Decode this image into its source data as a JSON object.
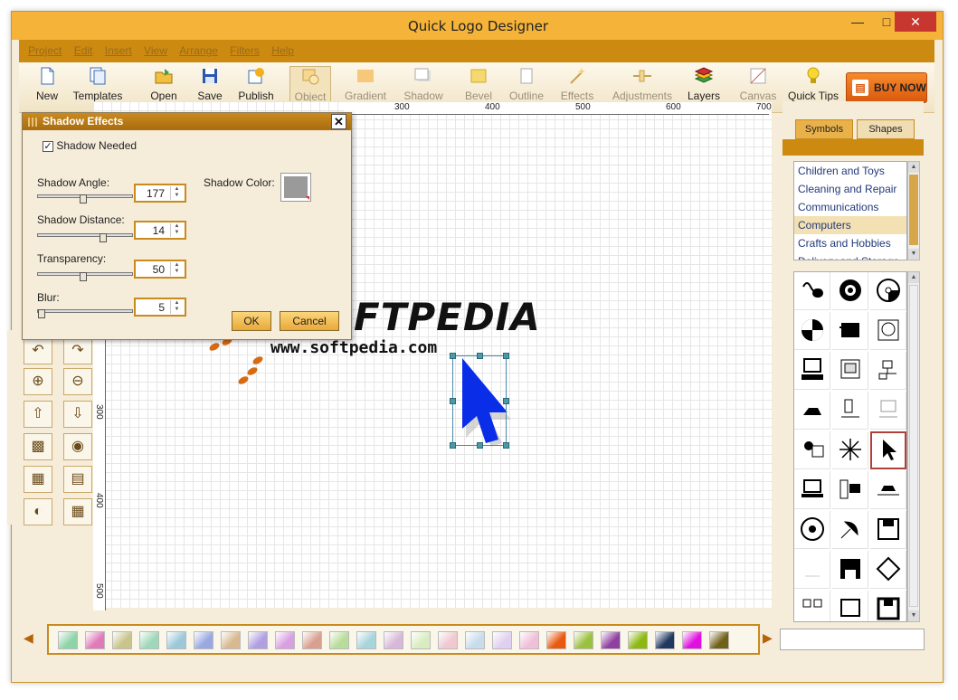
{
  "window": {
    "title": "Quick Logo Designer"
  },
  "menu": [
    "Project",
    "Edit",
    "Insert",
    "View",
    "Arrange",
    "Filters",
    "Help"
  ],
  "toolbar": {
    "new": "New",
    "templates": "Templates",
    "open": "Open",
    "save": "Save",
    "publish": "Publish",
    "object": "Object",
    "gradient": "Gradient",
    "shadow": "Shadow",
    "bevel": "Bevel",
    "outline": "Outline",
    "effects": "Effects",
    "adjustments": "Adjustments",
    "layers": "Layers",
    "canvas": "Canvas",
    "quick_tips": "Quick Tips",
    "buy_now": "BUY NOW"
  },
  "dialog": {
    "title": "Shadow Effects",
    "shadow_needed": "Shadow Needed",
    "shadow_needed_checked": true,
    "angle_label": "Shadow Angle:",
    "angle_value": "177",
    "distance_label": "Shadow Distance:",
    "distance_value": "14",
    "transparency_label": "Transparency:",
    "transparency_value": "50",
    "blur_label": "Blur:",
    "blur_value": "5",
    "color_label": "Shadow Color:",
    "shadow_color": "#9a9a9a",
    "ok": "OK",
    "cancel": "Cancel"
  },
  "ruler": {
    "top": [
      "300",
      "400",
      "500",
      "600",
      "700"
    ],
    "left": [
      "300",
      "400",
      "500"
    ]
  },
  "canvas": {
    "logo_text": "FTPEDIA",
    "url_text": "www.softpedia.com",
    "cursor_color": "#0a2ee8"
  },
  "right_panel": {
    "tab_symbols": "Symbols",
    "tab_shapes": "Shapes",
    "categories": [
      "Children and Toys",
      "Cleaning and Repair",
      "Communications",
      "Computers",
      "Crafts and Hobbies",
      "Delivery and Storage"
    ],
    "selected_category": "Computers"
  },
  "gradients": [
    "#8fd4a8",
    "#e07ab8",
    "#c8c48a",
    "#9ed8b8",
    "#9cc8d8",
    "#9aa8e0",
    "#d8b890",
    "#b0a0e0",
    "#d8a0e0",
    "#d8a090",
    "#b8dc9a",
    "#a8d4dc",
    "#d8b8d8",
    "#d8ecc0",
    "#f0c8d0",
    "#c8dcec",
    "#e0d0f0",
    "#f0c0d8",
    "#e85a10",
    "#9cc040",
    "#9040a0",
    "#8cb810",
    "#203860",
    "#e010e0",
    "#706018"
  ]
}
